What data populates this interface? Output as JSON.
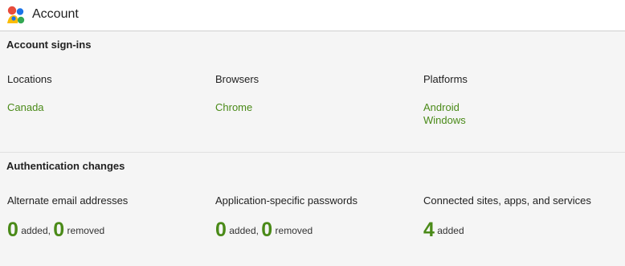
{
  "header": {
    "title": "Account",
    "logo_icon": "google-profile-logo-icon"
  },
  "colors": {
    "accent_green": "#4a8a18",
    "header_bg": "#ffffff",
    "page_bg": "#f5f5f5"
  },
  "signins": {
    "title": "Account sign-ins",
    "locations": {
      "label": "Locations",
      "items": [
        "Canada"
      ]
    },
    "browsers": {
      "label": "Browsers",
      "items": [
        "Chrome"
      ]
    },
    "platforms": {
      "label": "Platforms",
      "items": [
        "Android",
        "Windows"
      ]
    }
  },
  "auth_changes": {
    "title": "Authentication changes",
    "alternate_emails": {
      "label": "Alternate email addresses",
      "added_count": "0",
      "added_word": "added,",
      "removed_count": "0",
      "removed_word": "removed"
    },
    "app_passwords": {
      "label": "Application-specific passwords",
      "added_count": "0",
      "added_word": "added,",
      "removed_count": "0",
      "removed_word": "removed"
    },
    "connected_sites": {
      "label": "Connected sites, apps, and services",
      "added_count": "4",
      "added_word": "added"
    }
  }
}
